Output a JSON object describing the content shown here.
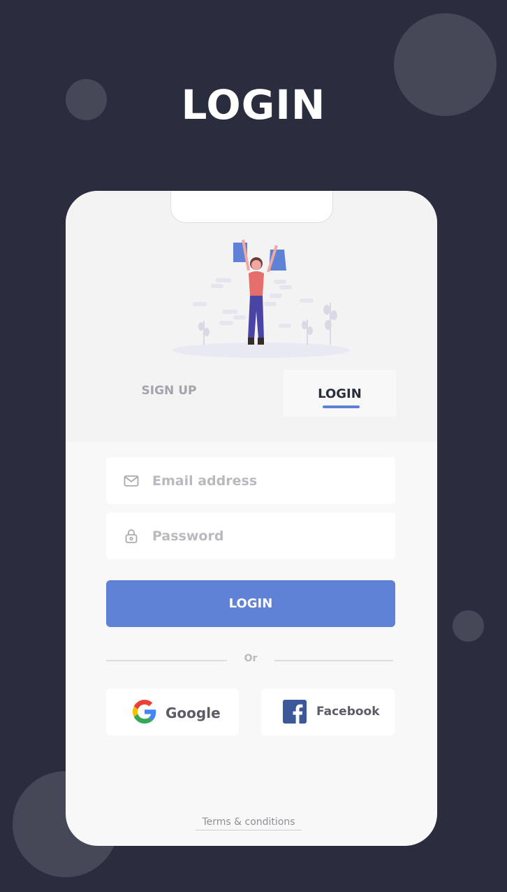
{
  "page": {
    "title": "LOGIN",
    "background_color": "#2a2d3e",
    "accent_color": "#5f81d6"
  },
  "tabs": [
    {
      "label": "SIGN UP",
      "active": false
    },
    {
      "label": "LOGIN",
      "active": true
    }
  ],
  "form": {
    "email": {
      "placeholder": "Email address",
      "value": "",
      "icon": "mail-icon"
    },
    "password": {
      "placeholder": "Password",
      "value": "",
      "icon": "lock-icon"
    },
    "submit_label": "LOGIN"
  },
  "divider_text": "Or",
  "social": {
    "google": {
      "label": "Google",
      "icon": "google-logo-icon"
    },
    "facebook": {
      "label": "Facebook",
      "icon": "facebook-logo-icon"
    }
  },
  "footer": {
    "terms_label": "Terms & conditions"
  }
}
